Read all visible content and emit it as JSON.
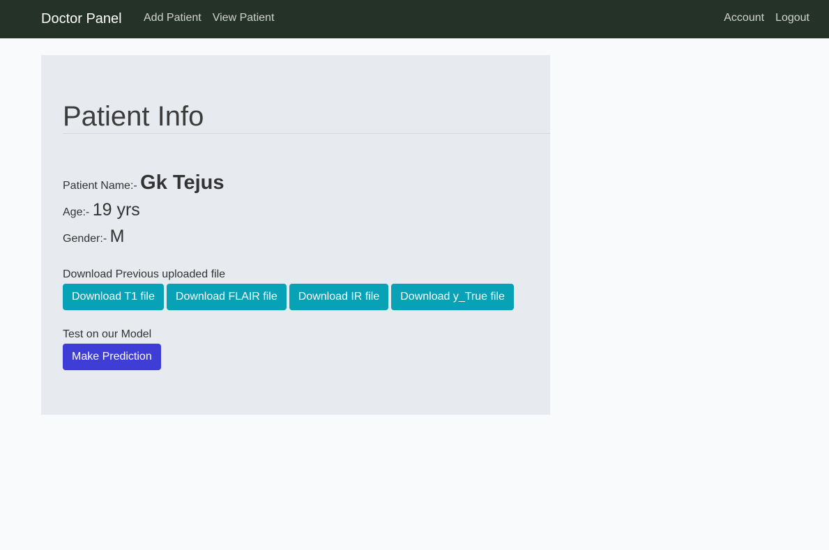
{
  "navbar": {
    "brand": "Doctor Panel",
    "left_links": [
      "Add Patient",
      "View Patient"
    ],
    "right_links": [
      "Account",
      "Logout"
    ]
  },
  "panel": {
    "title": "Patient Info",
    "patient": {
      "name_label": "Patient Name:-",
      "name": "Gk Tejus",
      "age_label": "Age:-",
      "age": "19 yrs",
      "gender_label": "Gender:-",
      "gender": "M"
    },
    "downloads": {
      "label": "Download Previous uploaded file",
      "buttons": [
        "Download T1 file",
        "Download FLAIR file",
        "Download IR file",
        "Download y_True file"
      ]
    },
    "model": {
      "label": "Test on our Model",
      "button": "Make Prediction"
    }
  },
  "colors": {
    "navbar_bg": "#243227",
    "panel_bg": "#e7eaef",
    "info_button": "#08a2b6",
    "primary_button": "#3e3ed6"
  }
}
